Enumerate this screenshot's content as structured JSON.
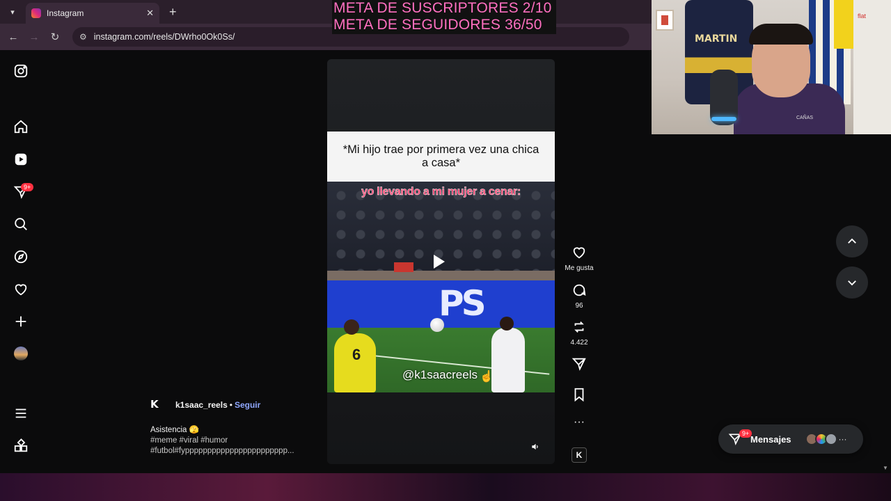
{
  "browser": {
    "tab_title": "Instagram",
    "url": "instagram.com/reels/DWrho0Ok0Ss/"
  },
  "overlay": {
    "line1": "META DE SUSCRIPTORES 2/10",
    "line2": "META DE SEGUIDORES 36/50"
  },
  "webcam": {
    "jersey_name": "MARTIN"
  },
  "sidebar": {
    "notification_badge": "9+"
  },
  "reel": {
    "caption": "*Mi hijo trae por primera vez una chica a casa*",
    "video_text": "yo llevando a mi mujer a cenar:",
    "watermark": "@k1saacreels",
    "jersey_number": "6",
    "author": "k1saac_reels",
    "author_logo": "K",
    "separator": "•",
    "follow": "Seguir",
    "description_title": "Asistencia 🫣",
    "description_tags": "#meme #viral #humor #futbol#fyppppppppppppppppppppppp..."
  },
  "actions": {
    "like_label": "Me gusta",
    "comments": "96",
    "reposts": "4.422"
  },
  "messages": {
    "label": "Mensajes",
    "badge": "9+"
  },
  "colors": {
    "overlay_text": "#ff6fc0",
    "follow_link": "#8fa7ff",
    "badge": "#ff3040"
  }
}
